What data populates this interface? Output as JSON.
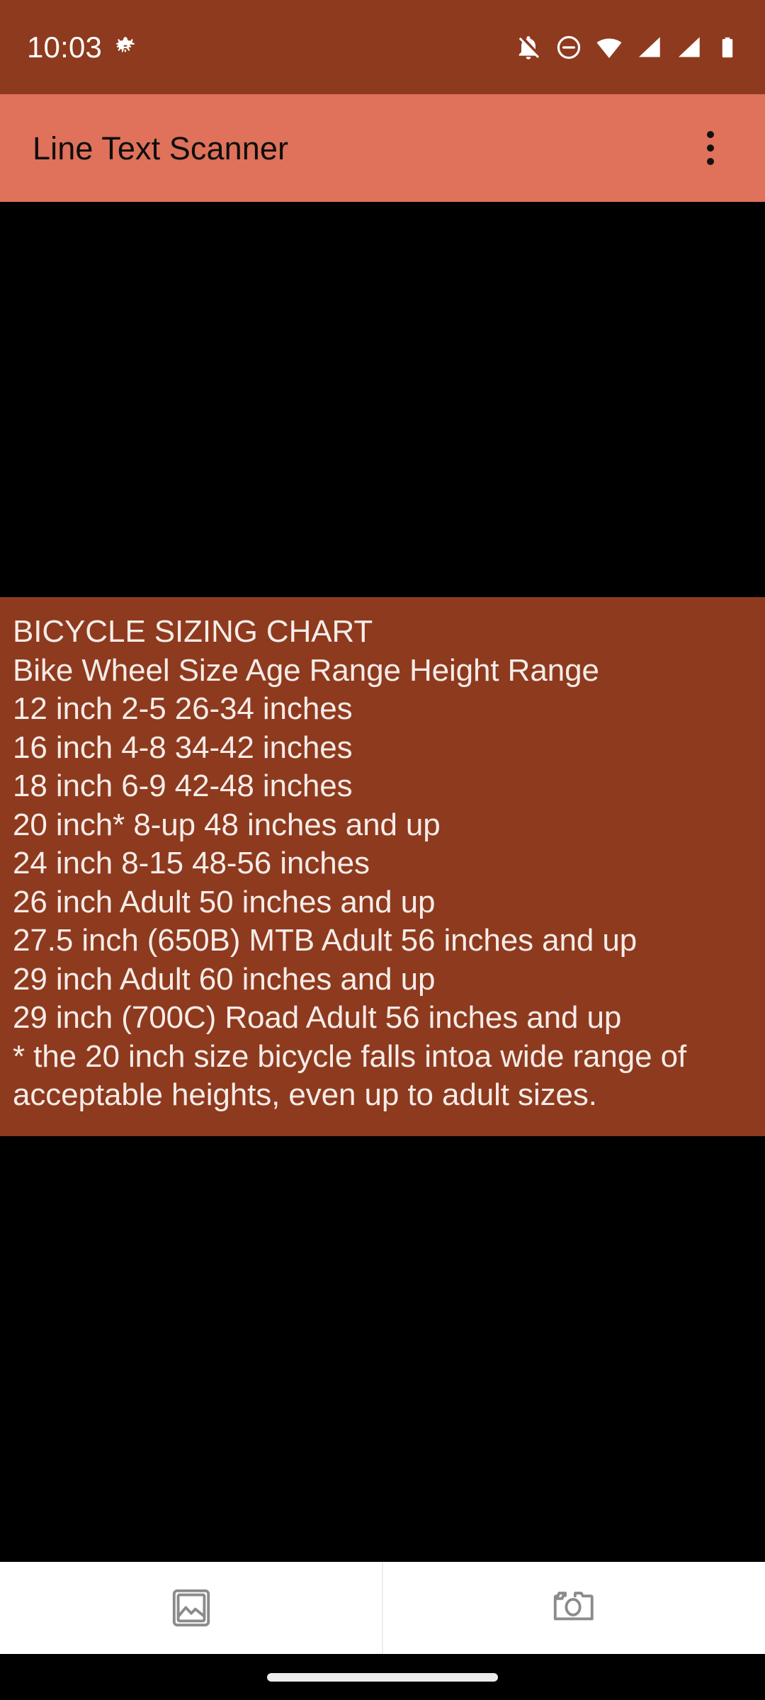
{
  "status_bar": {
    "time": "10:03",
    "icons": [
      {
        "name": "bug-icon",
        "position": "left"
      },
      {
        "name": "notifications-off-icon",
        "position": "right"
      },
      {
        "name": "do-not-disturb-icon",
        "position": "right"
      },
      {
        "name": "wifi-icon",
        "position": "right"
      },
      {
        "name": "cellular-signal-icon",
        "position": "right"
      },
      {
        "name": "cellular-signal-2-icon",
        "position": "right"
      },
      {
        "name": "battery-icon",
        "position": "right"
      }
    ],
    "background_color": "#8e3a1e",
    "foreground_color": "#ffffff"
  },
  "app_bar": {
    "title": "Line Text Scanner",
    "overflow_menu_label": "More options",
    "background_color": "#e0715a",
    "title_color": "#0e0e0e"
  },
  "scan_result": {
    "background_color": "#8e3a1e",
    "text_color": "#f5ece8",
    "lines": [
      "BICYCLE SIZING CHART",
      "Bike Wheel Size Age Range Height Range",
      "12 inch 2-5 26-34 inches",
      "16 inch 4-8 34-42 inches",
      "18 inch 6-9 42-48 inches",
      "20 inch* 8-up 48 inches and up",
      "24 inch 8-15 48-56 inches",
      "26 inch Adult 50 inches and up",
      "27.5 inch (650B) MTB Adult 56 inches and up",
      "29 inch Adult 60 inches and up",
      "29 inch (700C) Road Adult 56 inches and up",
      "* the 20 inch size bicycle falls intoa wide range of",
      "acceptable heights, even up to adult sizes."
    ]
  },
  "bottom_bar": {
    "background_color": "#ffffff",
    "buttons": [
      {
        "name": "gallery-button",
        "icon": "image-icon",
        "label": "Pick image from gallery"
      },
      {
        "name": "camera-button",
        "icon": "camera-icon",
        "label": "Capture with camera"
      }
    ]
  },
  "nav_bar": {
    "gesture_pill_label": "Home gesture bar"
  }
}
